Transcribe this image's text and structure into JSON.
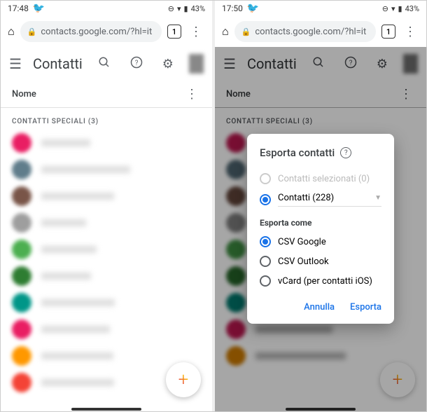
{
  "left": {
    "status": {
      "time": "17:48",
      "battery": "43%"
    },
    "url": "contacts.google.com/?hl=it",
    "tab_count": "1",
    "app_title": "Contatti",
    "name_label": "Nome",
    "section_header": "CONTATTI SPECIALI (3)"
  },
  "right": {
    "status": {
      "time": "17:50",
      "battery": "43%"
    },
    "url": "contacts.google.com/?hl=it",
    "tab_count": "1",
    "app_title": "Contatti",
    "name_label": "Nome",
    "section_header": "CONTATTI SPECIALI (3)"
  },
  "dialog": {
    "title": "Esporta contatti",
    "opt_selected_disabled": "Contatti selezionati (0)",
    "opt_all": "Contatti (228)",
    "format_label": "Esporta come",
    "formats": {
      "csv_google": "CSV Google",
      "csv_outlook": "CSV Outlook",
      "vcard": "vCard (per contatti iOS)"
    },
    "cancel": "Annulla",
    "confirm": "Esporta"
  },
  "avatars": [
    "#e91e63",
    "#607d8b",
    "#795548",
    "#9e9e9e",
    "#4caf50",
    "#2e7d32",
    "#009688",
    "#e91e63",
    "#ff9800",
    "#f44336"
  ]
}
